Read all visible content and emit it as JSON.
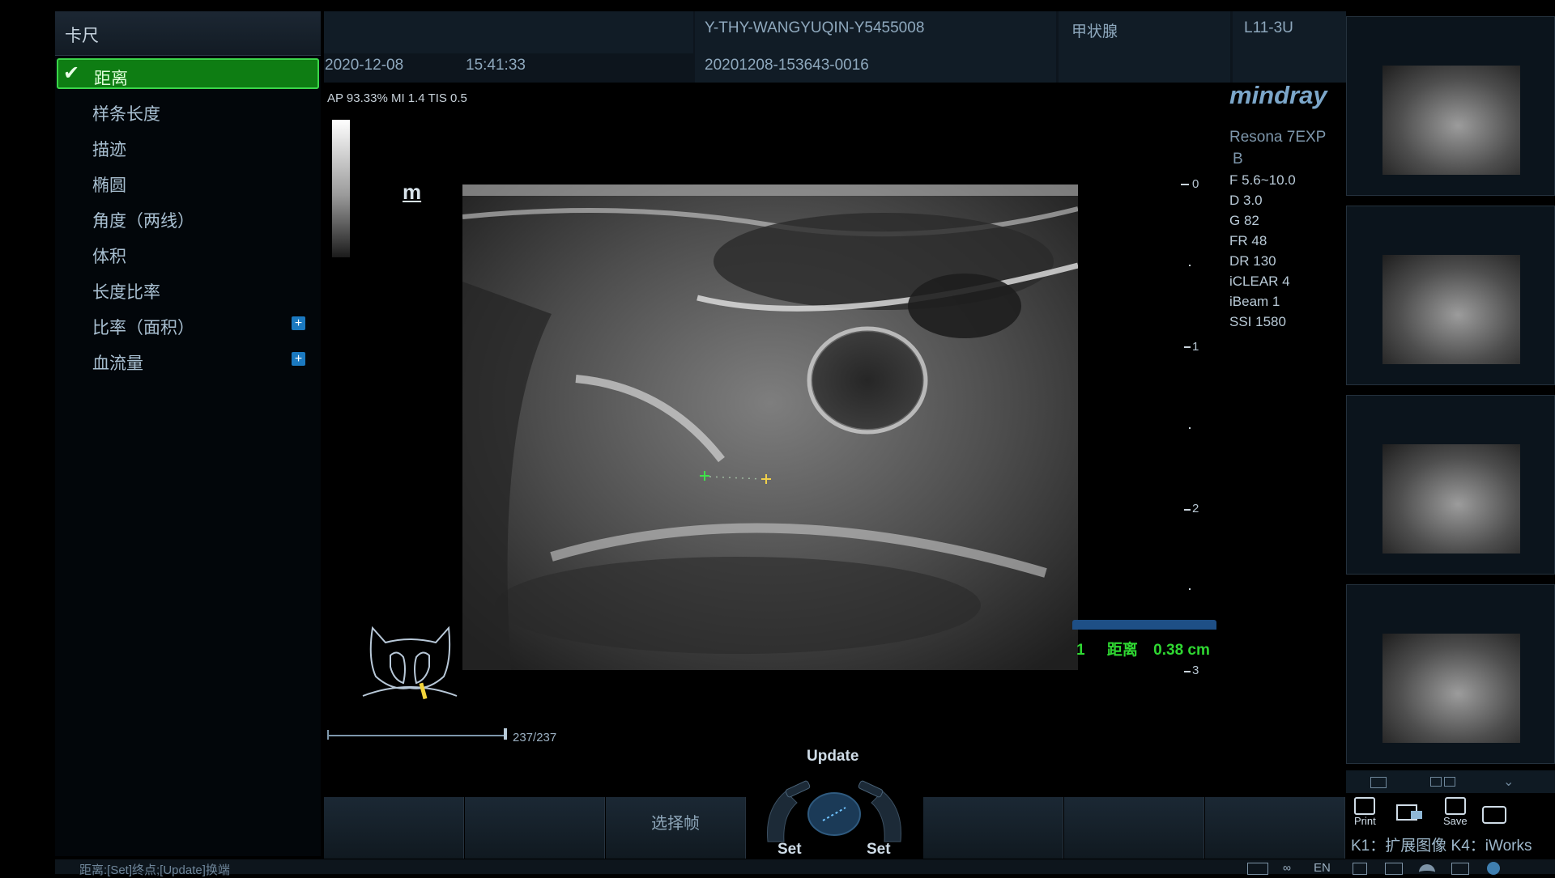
{
  "menu": {
    "title": "卡尺",
    "items": [
      {
        "label": "距离"
      },
      {
        "label": "样条长度"
      },
      {
        "label": "描迹"
      },
      {
        "label": "椭圆"
      },
      {
        "label": "角度（两线）"
      },
      {
        "label": "体积"
      },
      {
        "label": "长度比率"
      },
      {
        "label": "比率（面积）"
      },
      {
        "label": "血流量"
      }
    ]
  },
  "header": {
    "patient_id": "Y-THY-WANGYUQIN-Y5455008",
    "exam_type": "甲状腺",
    "probe": "L11-3U",
    "date": "2020-12-08",
    "time": "15:41:33",
    "exam_id": "20201208-153643-0016"
  },
  "image": {
    "params": "AP 93.33%  MI 1.4 TIS 0.5",
    "depth_marks": [
      "0",
      "1",
      "2",
      "3"
    ],
    "cine_frames": "237/237",
    "m_marker": "m"
  },
  "system": {
    "brand": "mindray",
    "model": "Resona 7EXP",
    "mode": "B",
    "settings": [
      "F 5.6~10.0",
      "D 3.0",
      "G 82",
      "FR 48",
      "DR 130",
      "iCLEAR 4",
      "iBeam 1",
      "SSI 1580"
    ]
  },
  "measurement": {
    "index": "1",
    "name": "距离",
    "value": "0.38 cm",
    "accent": "#2fd832"
  },
  "bottom": {
    "select_frame": "选择帧",
    "update": "Update",
    "set_left": "Set",
    "set_right": "Set",
    "print": "Print",
    "save": "Save",
    "keys": "K1：扩展图像   K4：iWorks",
    "status": "距离:[Set]终点;[Update]换端",
    "lang": "EN"
  }
}
